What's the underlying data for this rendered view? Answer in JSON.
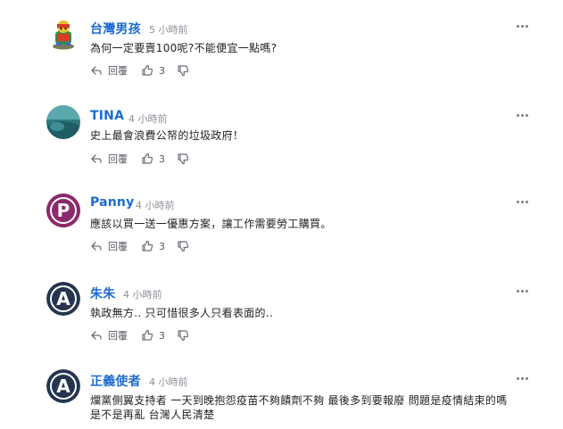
{
  "comments": [
    {
      "name": "台灣男孩",
      "time": "5 小時前",
      "text": "為何一定要賣100呢?不能便宜一點嗎?",
      "reply_label": "回覆",
      "likes": "3"
    },
    {
      "name": "TINA",
      "time": "4 小時前",
      "text": "史上最會浪費公帑的垃圾政府！",
      "reply_label": "回覆",
      "likes": "3"
    },
    {
      "name": "Panny",
      "time": "4 小時前",
      "text": "應該以買一送一優惠方案，讓工作需要勞工購買。",
      "reply_label": "回覆",
      "likes": "3"
    },
    {
      "name": "朱朱",
      "time": "4 小時前",
      "text": "執政無方.. 只可惜很多人只看表面的..",
      "reply_label": "回覆",
      "likes": "3"
    },
    {
      "name": "正義使者",
      "time": "4 小時前",
      "text_line1": "爛黨側翼支持者 一天到晚抱怨疫苗不夠饋劑不夠 最後多到要報廢 問題是疫情結束的嗎",
      "text_line2": "是不是再亂 台灣人民清楚"
    }
  ],
  "avatars": {
    "panny_letter": "P",
    "letter_a": "A"
  },
  "colors": {
    "name": "#1d6bd0",
    "text": "#222222",
    "meta": "#8a8f96",
    "avatar_purple": "#8c2a6b",
    "avatar_navy": "#27344f",
    "avatar_teal": "#2a7f86"
  },
  "icons": [
    "toy-avatar",
    "teal-photo-avatar",
    "letter-avatar",
    "more-horizontal-icon",
    "reply-arrow-icon",
    "thumbs-up-icon",
    "thumbs-down-icon"
  ]
}
